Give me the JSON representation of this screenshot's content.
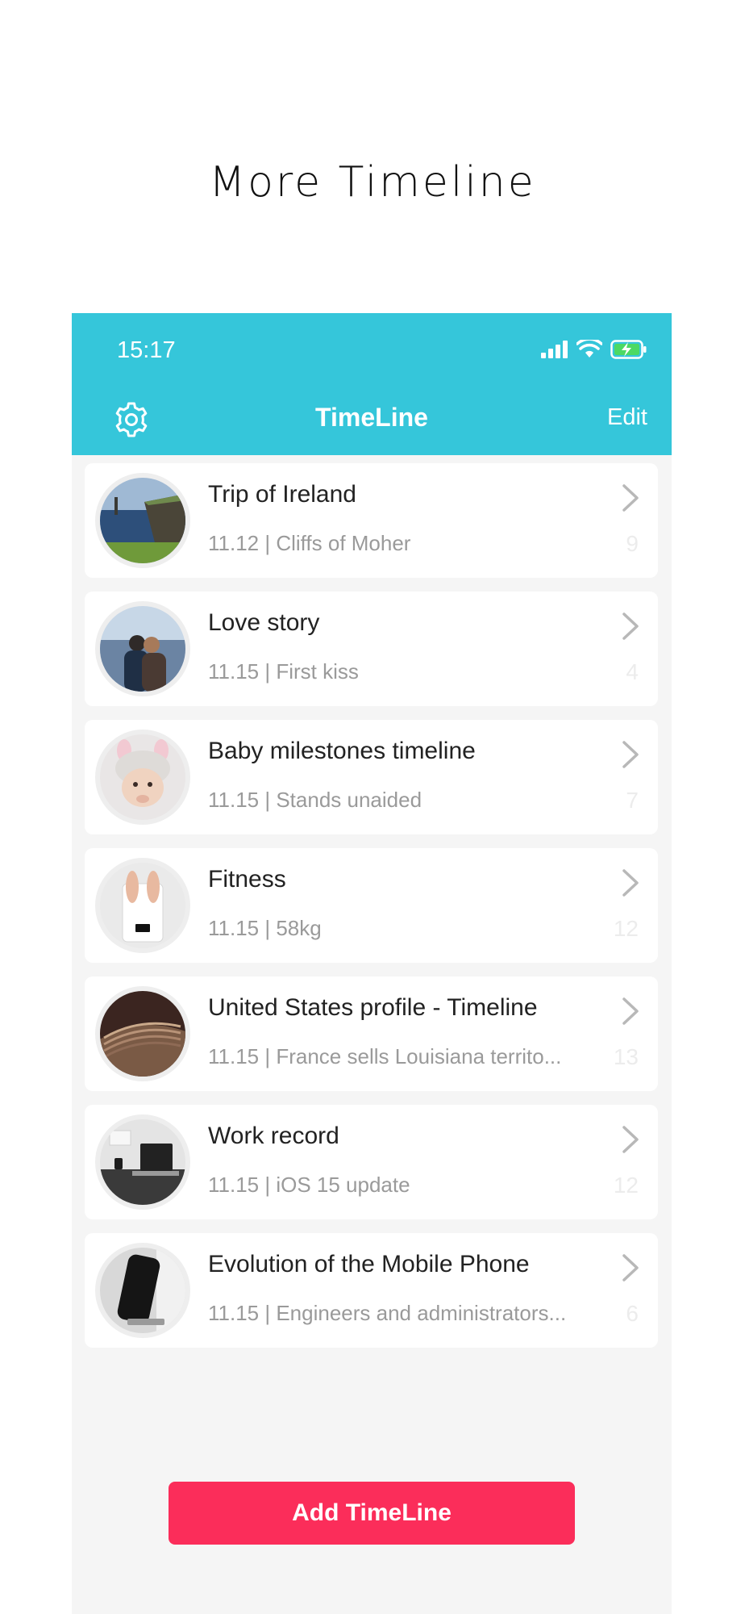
{
  "headline": "More Timeline",
  "status_bar": {
    "time": "15:17"
  },
  "nav": {
    "title": "TimeLine",
    "edit_label": "Edit",
    "settings_icon": "gear-icon"
  },
  "timelines": [
    {
      "title": "Trip of Ireland",
      "subtitle": "11.12 | Cliffs of Moher",
      "count": "9"
    },
    {
      "title": "Love story",
      "subtitle": "11.15 | First kiss",
      "count": "4"
    },
    {
      "title": "Baby milestones timeline",
      "subtitle": "11.15 | Stands unaided",
      "count": "7"
    },
    {
      "title": "Fitness",
      "subtitle": "11.15 | 58kg",
      "count": "12"
    },
    {
      "title": "United States profile - Timeline",
      "subtitle": "11.15 | France sells Louisiana territo...",
      "count": "13"
    },
    {
      "title": "Work record",
      "subtitle": "11.15 | iOS 15 update",
      "count": "12"
    },
    {
      "title": "Evolution of the Mobile Phone",
      "subtitle": "11.15 | Engineers and administrators...",
      "count": "6"
    }
  ],
  "add_button_label": "Add TimeLine",
  "colors": {
    "header": "#35c6da",
    "add_button": "#fb2d5a",
    "background": "#f5f5f5"
  }
}
